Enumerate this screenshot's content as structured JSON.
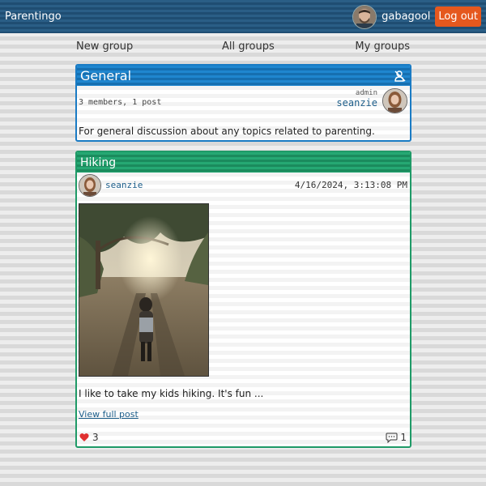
{
  "app": {
    "title": "Parentingo"
  },
  "user": {
    "name": "gabagool",
    "logout_label": "Log out"
  },
  "nav": {
    "new_group": "New group",
    "all_groups": "All groups",
    "my_groups": "My groups"
  },
  "group": {
    "name": "General",
    "stats": "3 members, 1 post",
    "admin_label": "admin",
    "admin_name": "seanzie",
    "description": "For general discussion about any topics related to parenting.",
    "leave_icon": "user-remove-icon",
    "accent": "#1a7bc4"
  },
  "post": {
    "title": "Hiking",
    "author": "seanzie",
    "timestamp": "4/16/2024, 3:13:08 PM",
    "excerpt": "I like to take my kids hiking. It's fun ...",
    "view_link": "View full post",
    "likes": "3",
    "comments": "1",
    "accent": "#1f9a67"
  },
  "colors": {
    "topbar": "#1f4d72",
    "logout": "#e5581e",
    "heart": "#e03030",
    "link": "#1d5e8a"
  }
}
